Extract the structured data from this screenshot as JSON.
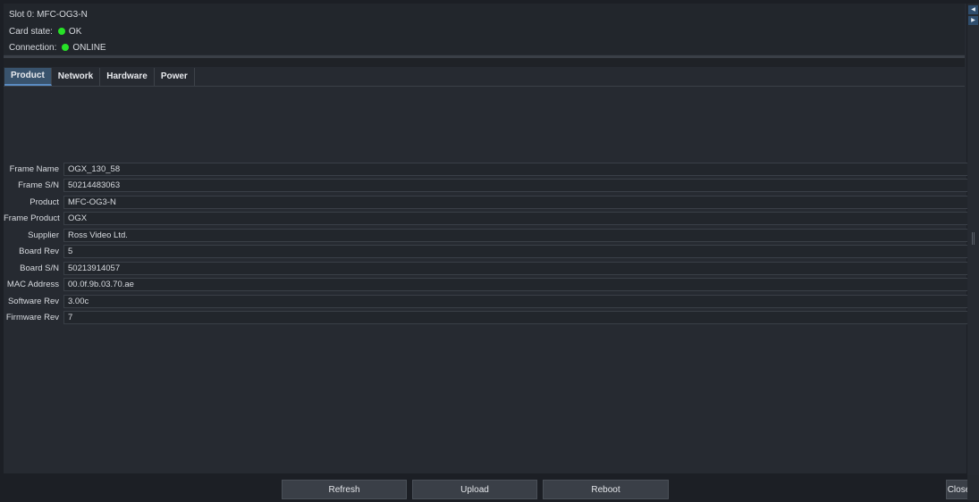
{
  "header": {
    "slot": "Slot 0: MFC-OG3-N",
    "card_state_label": "Card state:",
    "card_state_value": "OK",
    "connection_label": "Connection:",
    "connection_value": "ONLINE"
  },
  "tabs": [
    {
      "label": "Product",
      "active": true
    },
    {
      "label": "Network",
      "active": false
    },
    {
      "label": "Hardware",
      "active": false
    },
    {
      "label": "Power",
      "active": false
    }
  ],
  "fields": [
    {
      "label": "Frame Name",
      "value": "OGX_130_58"
    },
    {
      "label": "Frame S/N",
      "value": "50214483063"
    },
    {
      "label": "Product",
      "value": "MFC-OG3-N"
    },
    {
      "label": "Frame Product",
      "value": "OGX"
    },
    {
      "label": "Supplier",
      "value": "Ross Video Ltd."
    },
    {
      "label": "Board Rev",
      "value": "5"
    },
    {
      "label": "Board S/N",
      "value": "50213914057"
    },
    {
      "label": "MAC Address",
      "value": "00.0f.9b.03.70.ae"
    },
    {
      "label": "Software Rev",
      "value": "3.00c"
    },
    {
      "label": "Firmware Rev",
      "value": "7"
    }
  ],
  "buttons": {
    "refresh": "Refresh",
    "upload": "Upload",
    "reboot": "Reboot",
    "close": "Close"
  },
  "colors": {
    "status_ok": "#27e227",
    "active_tab": "#39536d",
    "background": "#262a31"
  },
  "icons": {
    "scroll_up": "triangle-left-icon",
    "scroll_down": "triangle-right-icon",
    "status": "status-dot-icon"
  }
}
